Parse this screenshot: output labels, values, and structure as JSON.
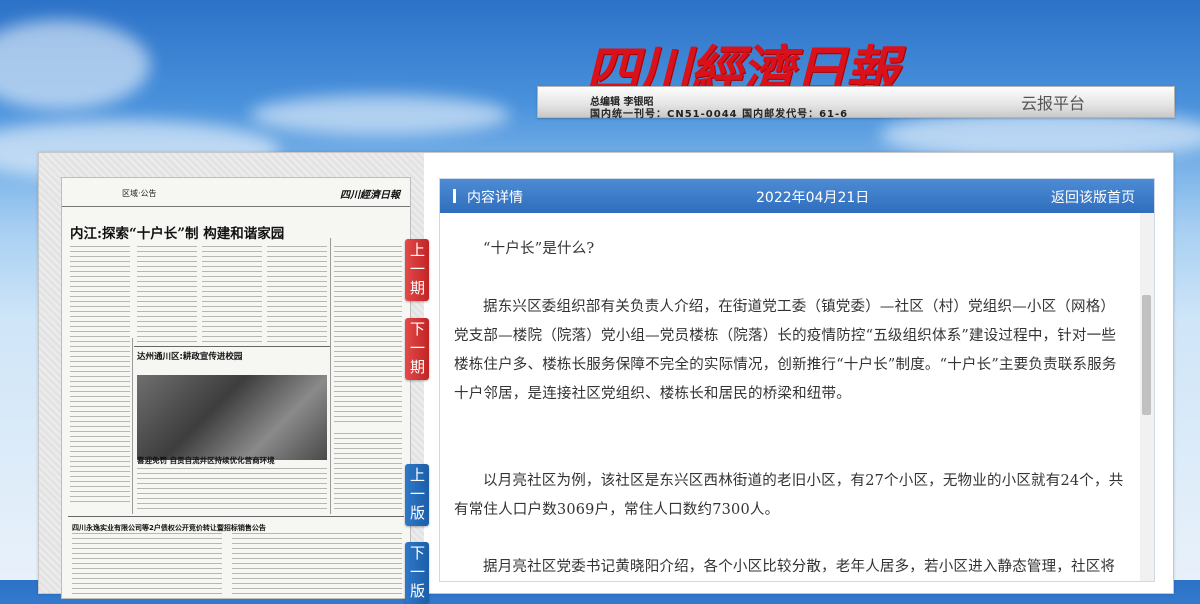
{
  "masthead": {
    "logo_text": "四川經濟日報",
    "editor_line": "总编辑  李银昭",
    "cn_line": "国内统一刊号：CN51-0044  国内邮发代号：61-6",
    "platform": "云报平台"
  },
  "newspaper_page": {
    "section": "区域·公告",
    "logo": "四川經濟日報",
    "headline": "内江:探索“十户长”制  构建和谐家园",
    "photo_title": "达州通川区:耕政宣传进校园",
    "sub_title": "喜迎免罚  自贡自流井区持续优化营商环境",
    "ad_title": "四川永逸实业有限公司等2户债权公开竞价转让暨招标销售公告"
  },
  "side_tabs": [
    {
      "label": "上一期",
      "color": "#d6302f"
    },
    {
      "label": "下一期",
      "color": "#d6302f"
    },
    {
      "label": "上一版",
      "color": "#2469b8"
    },
    {
      "label": "下一版",
      "color": "#2469b8"
    }
  ],
  "content": {
    "title": "内容详情",
    "date": "2022年04月21日",
    "back_link": "返回该版首页",
    "paragraphs": [
      "“十户长”是什么?",
      "据东兴区委组织部有关负责人介绍，在街道党工委（镇党委）—社区（村）党组织—小区（网格）党支部—楼院（院落）党小组—党员楼栋（院落）长的疫情防控“五级组织体系”建设过程中，针对一些楼栋住户多、楼栋长服务保障不完全的实际情况，创新推行“十户长”制度。“十户长”主要负责联系服务十户邻居，是连接社区党组织、楼栋长和居民的桥梁和纽带。",
      "以月亮社区为例，该社区是东兴区西林街道的老旧小区，有27个小区，无物业的小区就有24个，共有常住人口户数3069户，常住人口数约7300人。",
      "据月亮社区党委书记黄晓阳介绍，各个小区比较分散，老年人居多，若小区进入静态管理，社区将面"
    ]
  },
  "colors": {
    "header_blue": "#3a7bc9",
    "logo_red": "#d8111a",
    "tab_red": "#d6302f",
    "tab_blue": "#2469b8"
  }
}
